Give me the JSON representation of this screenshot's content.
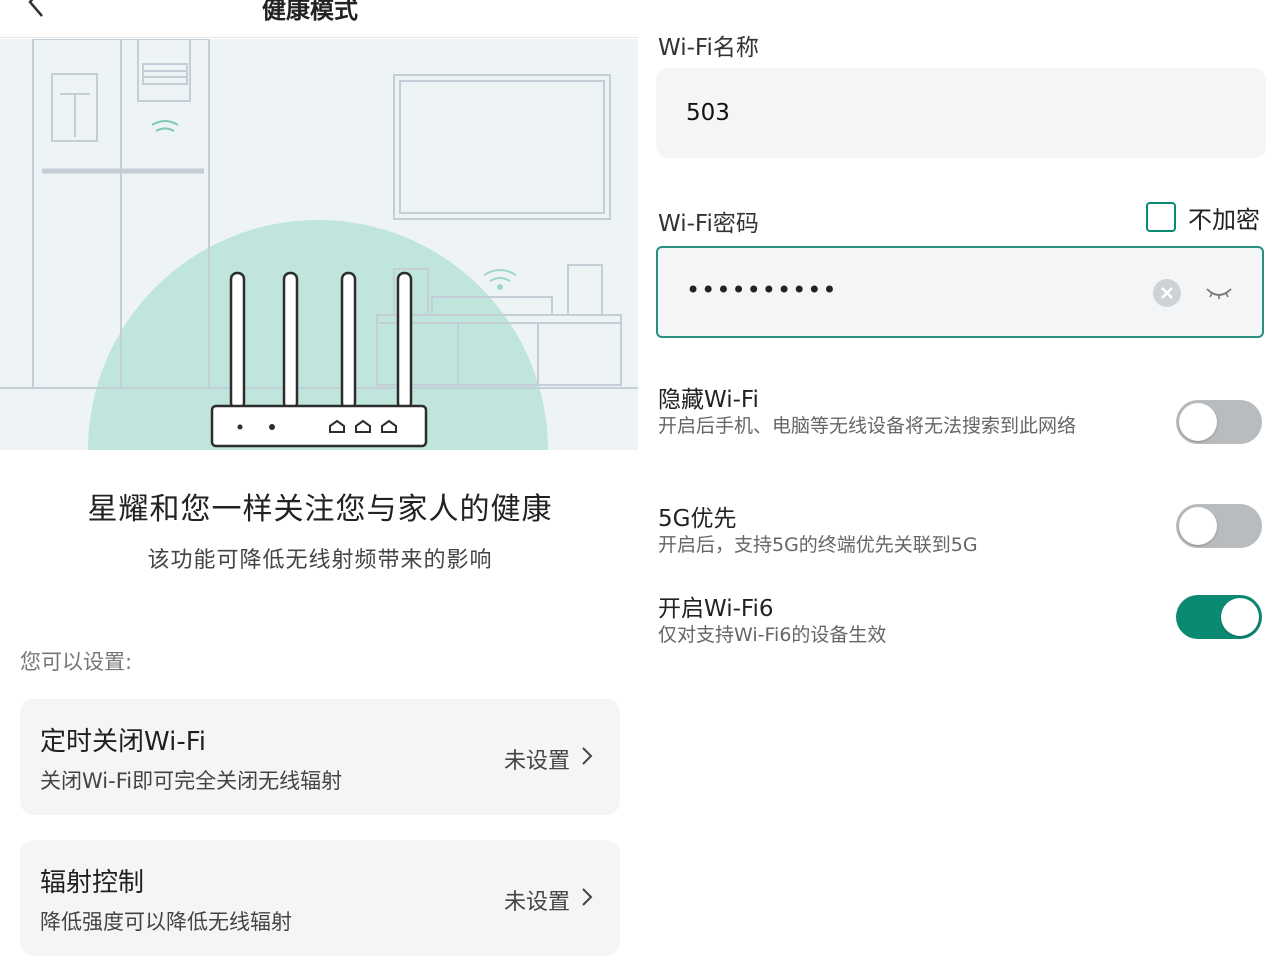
{
  "header": {
    "title": "健康模式"
  },
  "hero": {
    "headline": "星耀和您一样关注您与家人的健康",
    "subline": "该功能可降低无线射频带来的影响"
  },
  "settings": {
    "section_label": "您可以设置:",
    "cards": [
      {
        "title": "定时关闭Wi-Fi",
        "desc": "关闭Wi-Fi即可完全关闭无线辐射",
        "status": "未设置"
      },
      {
        "title": "辐射控制",
        "desc": "降低强度可以降低无线辐射",
        "status": "未设置"
      }
    ]
  },
  "wifi": {
    "ssid_label": "Wi-Fi名称",
    "ssid_value": "503",
    "password_label": "Wi-Fi密码",
    "password_value": "••••••••••",
    "no_encryption_label": "不加密",
    "no_encryption_checked": false
  },
  "toggles": [
    {
      "title": "隐藏Wi-Fi",
      "desc": "开启后手机、电脑等无线设备将无法搜索到此网络",
      "on": false
    },
    {
      "title": "5G优先",
      "desc": "开启后，支持5G的终端优先关联到5G",
      "on": false
    },
    {
      "title": "开启Wi-Fi6",
      "desc": "仅对支持Wi-Fi6的设备生效",
      "on": true
    }
  ],
  "colors": {
    "accent": "#0b8a72",
    "card_bg": "#f3f5f7",
    "switch_off": "#b9bcbf",
    "illustration_glow": "#bfe5dc"
  },
  "icons": {
    "back": "chevron-left-icon",
    "chevron": "chevron-right-icon",
    "clear": "clear-circle-icon",
    "password_visibility": "eye-off-icon"
  }
}
